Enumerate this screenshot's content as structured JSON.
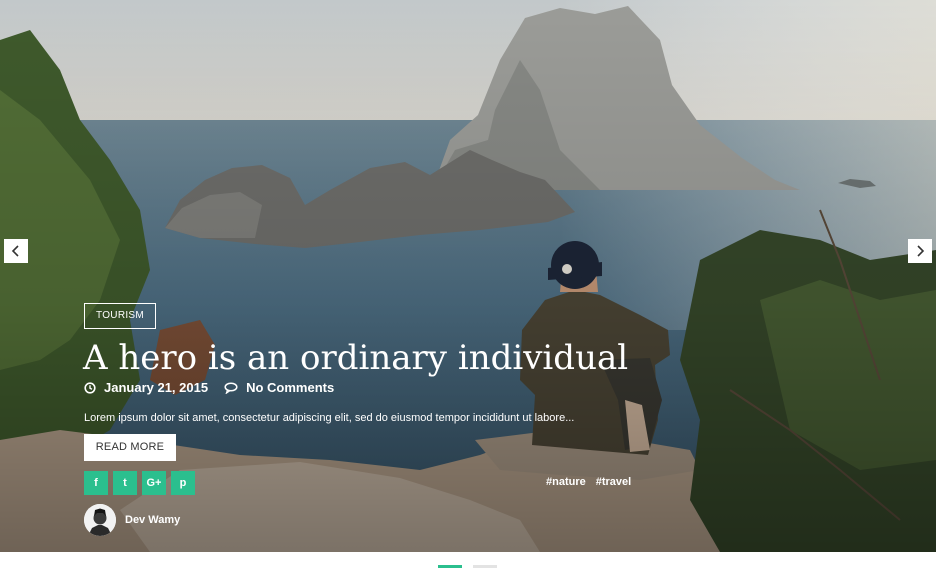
{
  "slider": {
    "prev_icon": "chevron-left-icon",
    "next_icon": "chevron-right-icon",
    "slide_count": 2,
    "active_slide": 1
  },
  "post": {
    "category": "TOURISM",
    "title": "A hero is an ordinary individual",
    "date": "January 21, 2015",
    "comments": "No Comments",
    "excerpt": "Lorem ipsum dolor sit amet, consectetur adipiscing elit, sed do eiusmod tempor incididunt ut labore...",
    "read_more_label": "READ MORE",
    "author_name": "Dev Wamy",
    "tags": [
      "#nature",
      "#travel"
    ]
  },
  "social": [
    {
      "name": "facebook",
      "glyph": "f"
    },
    {
      "name": "twitter",
      "glyph": "t"
    },
    {
      "name": "google-plus",
      "glyph": "G+"
    },
    {
      "name": "pinterest",
      "glyph": "p"
    }
  ],
  "colors": {
    "accent": "#2bbf8e",
    "pager_inactive": "#e3e3e3",
    "button_bg": "#ffffff"
  }
}
